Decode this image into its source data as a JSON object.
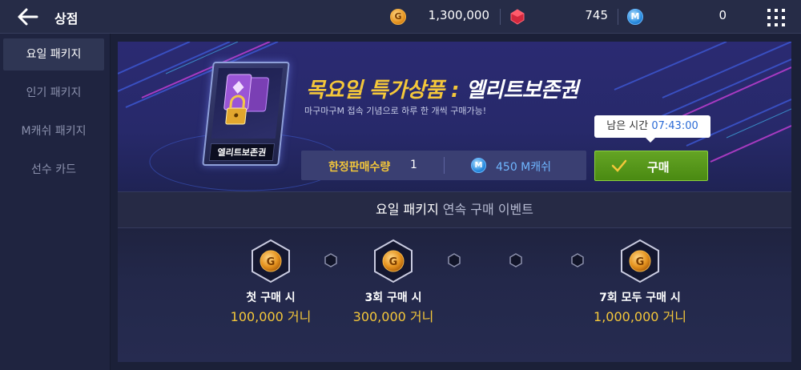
{
  "header": {
    "title": "상점",
    "gold_value": "1,300,000",
    "gold_icon_glyph": "G",
    "gem_value": "745",
    "m_value": "0",
    "m_icon_glyph": "M"
  },
  "sidebar": {
    "items": [
      {
        "label": "요일 패키지",
        "active": true
      },
      {
        "label": "인기 패키지",
        "active": false
      },
      {
        "label": "M캐쉬 패키지",
        "active": false
      },
      {
        "label": "선수 카드",
        "active": false
      }
    ]
  },
  "banner": {
    "card_label": "엘리트보존권",
    "headline_yellow": "목요일 특가상품 : ",
    "headline_white": "엘리트보존권",
    "subline": "마구마구M 접속 기념으로 하루 한 개씩 구매가능!",
    "timer_label": "남은 시간",
    "timer_value": "07:43:00",
    "limit_label": "한정판매수량",
    "limit_value": "1",
    "price_icon_glyph": "M",
    "price": "450 M캐쉬",
    "buy_label": "구매"
  },
  "event": {
    "title_main": "요일 패키지",
    "title_sub": " 연속 구매 이벤트",
    "rewards": [
      {
        "title": "첫 구매 시",
        "amount": "100,000 거니"
      },
      {
        "title": "3회 구매 시",
        "amount": "300,000 거니"
      },
      {
        "title": "7회 모두 구매 시",
        "amount": "1,000,000 거니"
      }
    ]
  },
  "colors": {
    "accent_gold": "#f4c73a",
    "buy_green": "#5a9a1c",
    "m_blue": "#6fb6ff"
  }
}
